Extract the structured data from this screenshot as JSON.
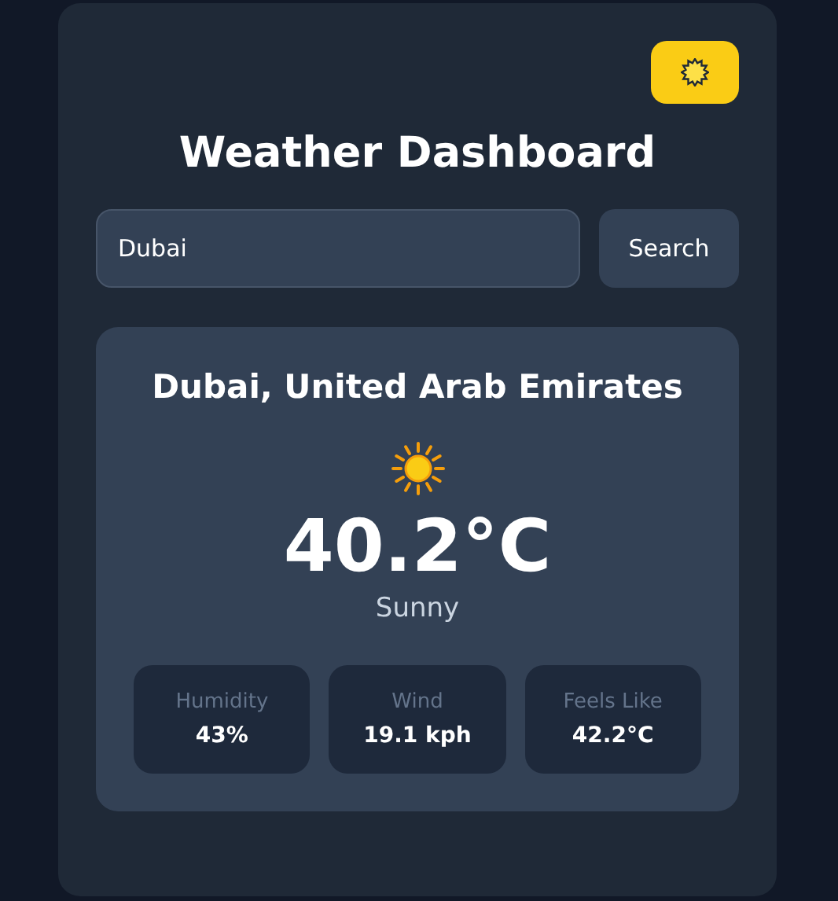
{
  "title": "Weather Dashboard",
  "search": {
    "value": "Dubai",
    "button": "Search"
  },
  "weather": {
    "location": "Dubai, United Arab Emirates",
    "temperature": "40.2°C",
    "condition": "Sunny",
    "stats": [
      {
        "label": "Humidity",
        "value": "43%"
      },
      {
        "label": "Wind",
        "value": "19.1 kph"
      },
      {
        "label": "Feels Like",
        "value": "42.2°C"
      }
    ]
  }
}
